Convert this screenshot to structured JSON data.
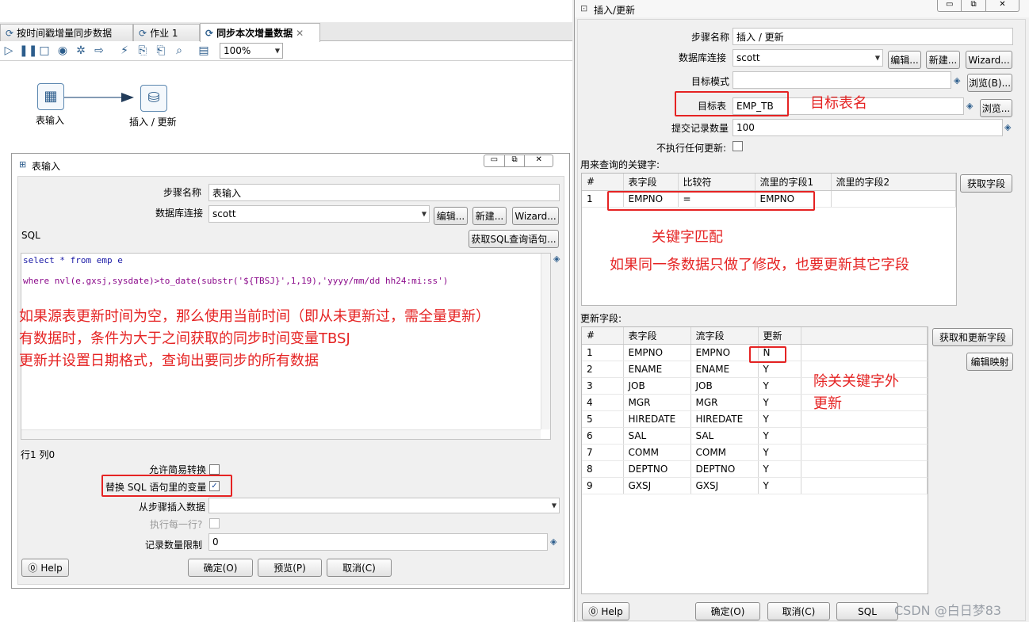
{
  "tabs": [
    "按时间戳增量同步数据",
    "作业 1",
    "同步本次增量数据"
  ],
  "toolbar": {
    "zoom": "100%"
  },
  "canvas": {
    "node1": "表输入",
    "node2": "插入 / 更新"
  },
  "table_input": {
    "title": "表输入",
    "step_name_label": "步骤名称",
    "step_name": "表输入",
    "db_conn_label": "数据库连接",
    "db_conn": "scott",
    "edit_btn": "编辑...",
    "new_btn": "新建...",
    "wizard_btn": "Wizard...",
    "sql_label": "SQL",
    "get_sql_btn": "获取SQL查询语句...",
    "sql_line1": "select * from emp e",
    "sql_line2": "where nvl(e.gxsj,sysdate)>to_date(substr('${TBSJ}',1,19),'yyyy/mm/dd hh24:mi:ss')",
    "annotation1": "如果源表更新时间为空，那么使用当前时间（即从未更新过，需全量更新）",
    "annotation2": "有数据时，条件为大于之间获取的同步时间变量TBSJ",
    "annotation3": "更新并设置日期格式，查询出要同步的所有数据",
    "cursor_pos": "行1 列0",
    "lazy_label": "允许简易转换",
    "replace_var_label": "替换 SQL 语句里的变量",
    "insert_from_label": "从步骤插入数据",
    "exec_each_label": "执行每一行?",
    "limit_label": "记录数量限制",
    "limit_value": "0",
    "help_btn": "Help",
    "ok_btn": "确定(O)",
    "preview_btn": "预览(P)",
    "cancel_btn": "取消(C)"
  },
  "insert_update": {
    "title": "插入/更新",
    "step_name_label": "步骤名称",
    "step_name": "插入 / 更新",
    "db_conn_label": "数据库连接",
    "db_conn": "scott",
    "edit_btn": "编辑...",
    "new_btn": "新建...",
    "wizard_btn": "Wizard...",
    "schema_label": "目标模式",
    "browse_btn1": "浏览(B)...",
    "table_label": "目标表",
    "table_value": "EMP_TB",
    "browse_btn2": "浏览...",
    "table_annotation": "目标表名",
    "commit_label": "提交记录数量",
    "commit_value": "100",
    "no_update_label": "不执行任何更新:",
    "keys_label": "用来查询的关键字:",
    "keys_headers": [
      "#",
      "表字段",
      "比较符",
      "流里的字段1",
      "流里的字段2"
    ],
    "keys_rows": [
      [
        "1",
        "EMPNO",
        "=",
        "EMPNO",
        ""
      ]
    ],
    "get_fields_btn": "获取字段",
    "key_annotation1": "关键字匹配",
    "key_annotation2": "如果同一条数据只做了修改，也要更新其它字段",
    "update_label": "更新字段:",
    "update_headers": [
      "#",
      "表字段",
      "流字段",
      "更新"
    ],
    "update_rows": [
      [
        "1",
        "EMPNO",
        "EMPNO",
        "N"
      ],
      [
        "2",
        "ENAME",
        "ENAME",
        "Y"
      ],
      [
        "3",
        "JOB",
        "JOB",
        "Y"
      ],
      [
        "4",
        "MGR",
        "MGR",
        "Y"
      ],
      [
        "5",
        "HIREDATE",
        "HIREDATE",
        "Y"
      ],
      [
        "6",
        "SAL",
        "SAL",
        "Y"
      ],
      [
        "7",
        "COMM",
        "COMM",
        "Y"
      ],
      [
        "8",
        "DEPTNO",
        "DEPTNO",
        "Y"
      ],
      [
        "9",
        "GXSJ",
        "GXSJ",
        "Y"
      ]
    ],
    "get_update_btn": "获取和更新字段",
    "edit_map_btn": "编辑映射",
    "update_annotation": "除关关键字外\n更新",
    "help_btn": "Help",
    "ok_btn": "确定(O)",
    "cancel_btn": "取消(C)",
    "sql_btn": "SQL"
  },
  "watermark": "CSDN @白日梦83"
}
